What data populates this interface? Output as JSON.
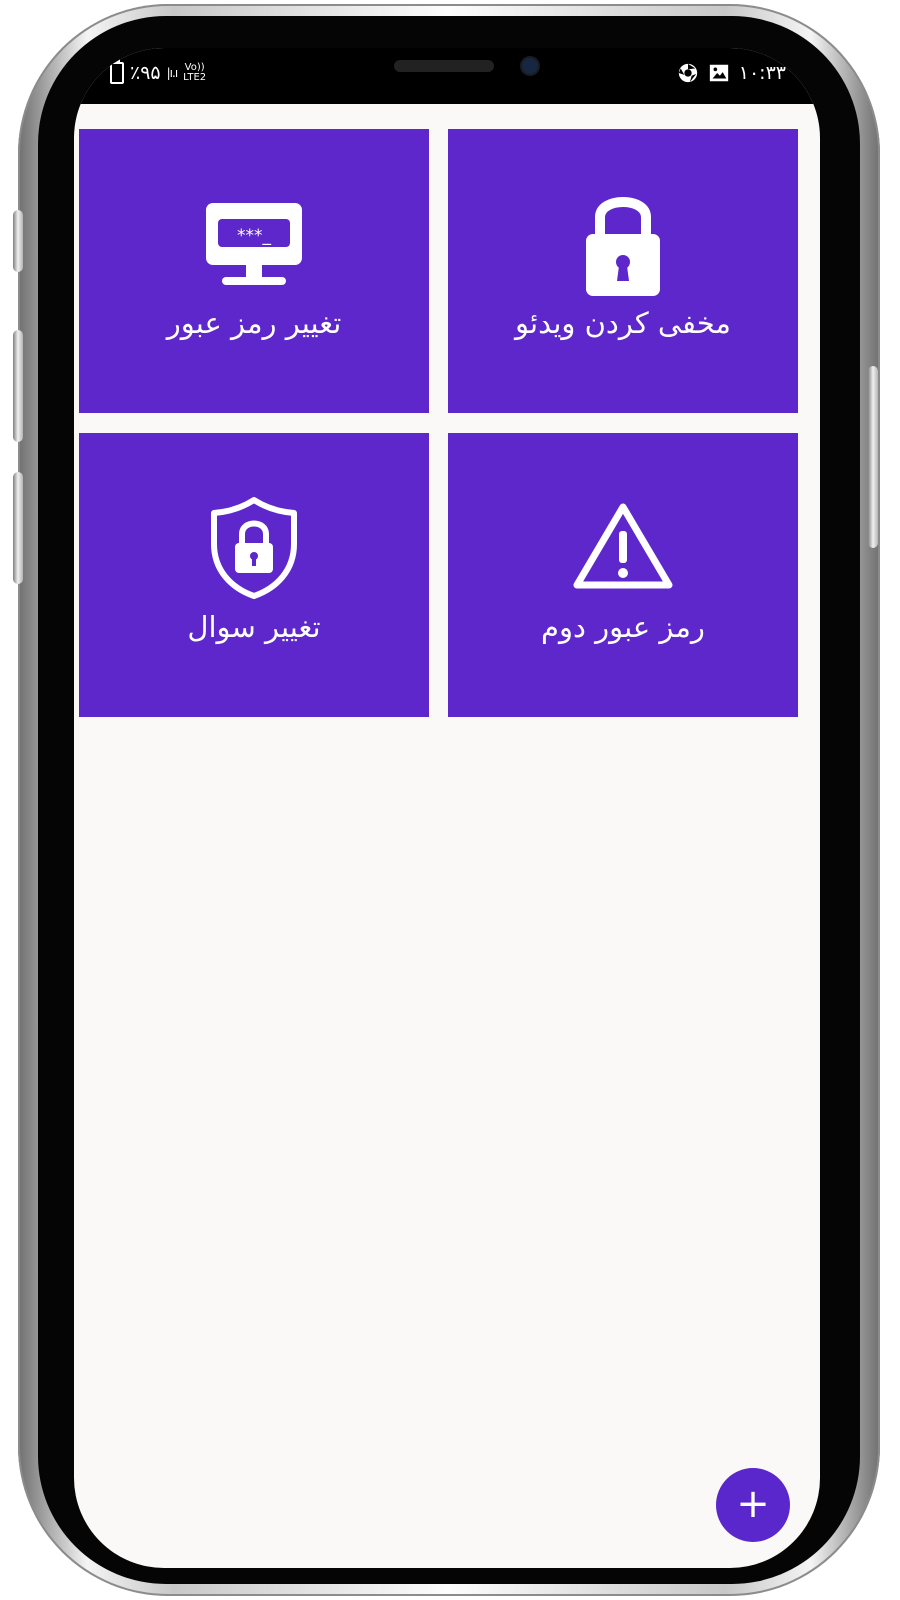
{
  "status_bar": {
    "battery": "٪۹۵",
    "network_top": "Vo))",
    "network_bottom": "LTE2",
    "time": "۱۰:۳۳",
    "icons": [
      "battery-icon",
      "signal-icon",
      "chrome-icon",
      "gallery-icon"
    ]
  },
  "tiles": [
    {
      "label": "مخفی کردن ویدئو",
      "icon": "lock-icon"
    },
    {
      "label": "تغییر رمز عبور",
      "icon": "password-screen-icon",
      "icon_text": "***_"
    },
    {
      "label": "رمز عبور دوم",
      "icon": "warning-icon"
    },
    {
      "label": "تغییر سوال",
      "icon": "shield-lock-icon"
    }
  ],
  "fab": {
    "label": "+"
  },
  "colors": {
    "tile": "#5d27cc",
    "background": "#fbf9f8",
    "status_bar": "#000000"
  }
}
